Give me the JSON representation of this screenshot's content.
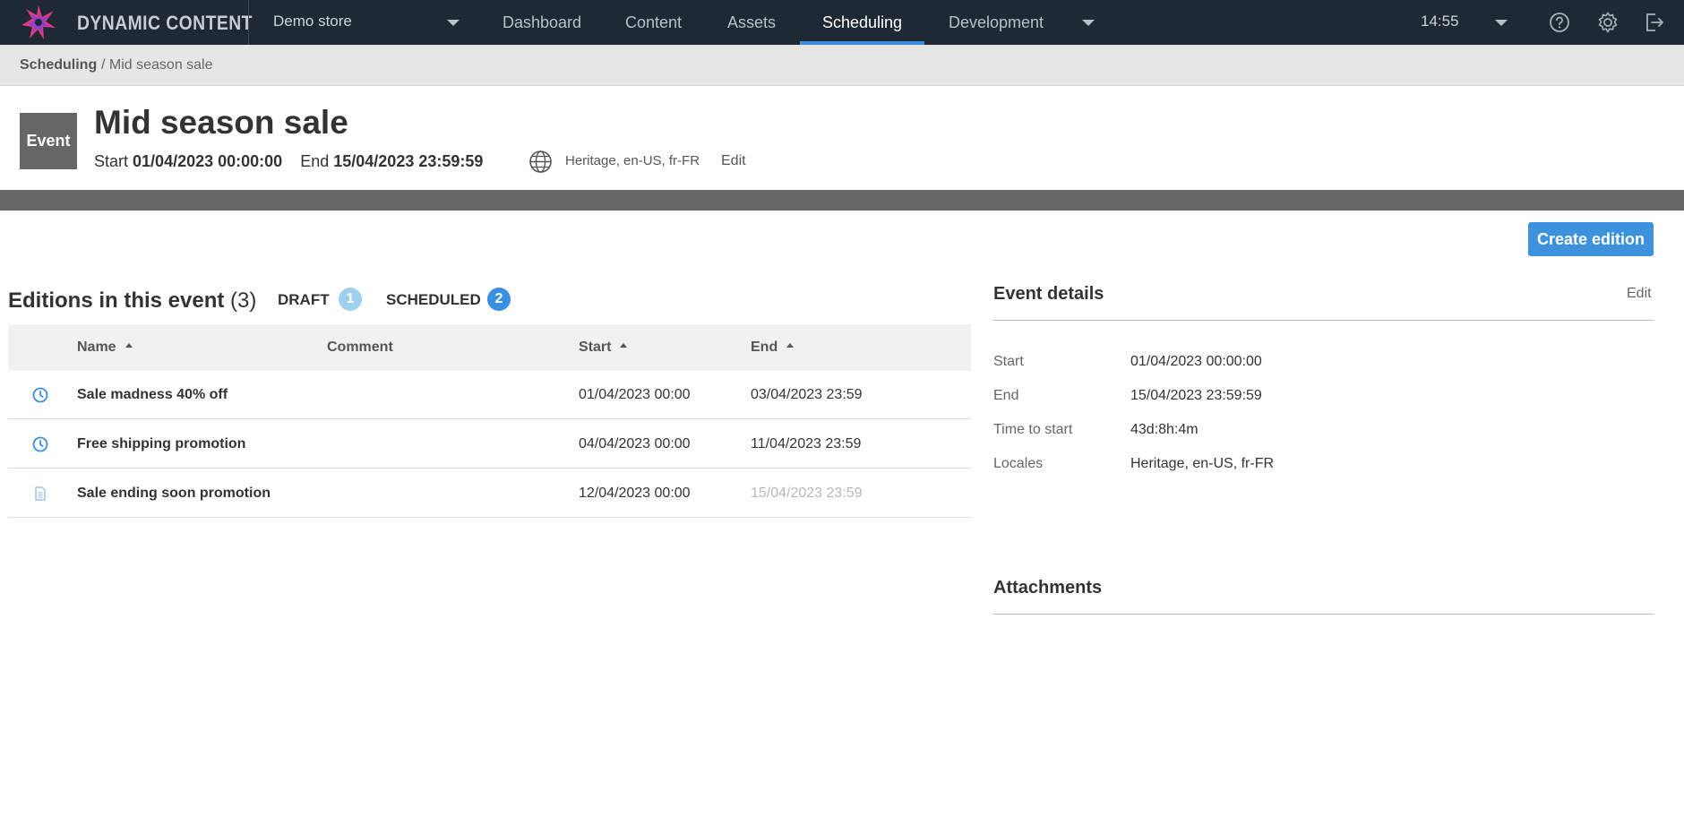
{
  "app": {
    "brand": "DYNAMIC CONTENT",
    "store": "Demo store",
    "nav": [
      "Dashboard",
      "Content",
      "Assets",
      "Scheduling",
      "Development"
    ],
    "active_nav": "Scheduling",
    "time": "14:55",
    "accent_color": "#3b8fe0"
  },
  "breadcrumb": {
    "root": "Scheduling",
    "current": "/ Mid season sale"
  },
  "event": {
    "badge": "Event",
    "title": "Mid season sale",
    "start_label": "Start",
    "start_value": "01/04/2023 00:00:00",
    "end_label": "End",
    "end_value": "15/04/2023 23:59:59",
    "locales": "Heritage, en-US, fr-FR",
    "edit_label": "Edit"
  },
  "actions": {
    "create_edition": "Create edition"
  },
  "editions": {
    "title": "Editions in this event",
    "count": "(3)",
    "statuses": [
      {
        "label": "DRAFT",
        "count": "1",
        "color": "#9fd0ef"
      },
      {
        "label": "SCHEDULED",
        "count": "2",
        "color": "#3b8fe0"
      }
    ],
    "columns": [
      "Name",
      "Comment",
      "Start",
      "End"
    ],
    "rows": [
      {
        "icon": "clock-icon",
        "name": "Sale madness 40% off",
        "comment": "",
        "start": "01/04/2023 00:00",
        "end": "03/04/2023 23:59",
        "end_muted": false
      },
      {
        "icon": "clock-icon",
        "name": "Free shipping promotion",
        "comment": "",
        "start": "04/04/2023 00:00",
        "end": "11/04/2023 23:59",
        "end_muted": false
      },
      {
        "icon": "document-icon",
        "name": "Sale ending soon promotion",
        "comment": "",
        "start": "12/04/2023 00:00",
        "end": "15/04/2023 23:59",
        "end_muted": true
      }
    ]
  },
  "details": {
    "title": "Event details",
    "edit_label": "Edit",
    "fields": [
      {
        "label": "Start",
        "value": "01/04/2023 00:00:00"
      },
      {
        "label": "End",
        "value": "15/04/2023 23:59:59"
      },
      {
        "label": "Time to start",
        "value": "43d:8h:4m"
      },
      {
        "label": "Locales",
        "value": "Heritage, en-US, fr-FR"
      }
    ]
  },
  "attachments": {
    "title": "Attachments"
  }
}
